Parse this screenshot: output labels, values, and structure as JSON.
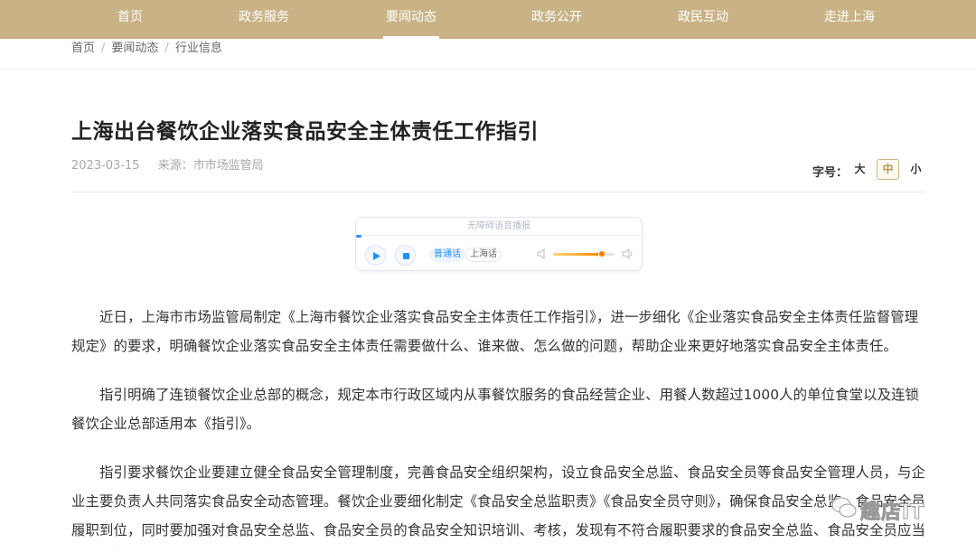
{
  "nav": {
    "items": [
      {
        "label": "首页"
      },
      {
        "label": "政务服务"
      },
      {
        "label": "要闻动态",
        "active": true
      },
      {
        "label": "政务公开"
      },
      {
        "label": "政民互动"
      },
      {
        "label": "走进上海"
      }
    ]
  },
  "breadcrumb": [
    "首页",
    "要闻动态",
    "行业信息"
  ],
  "article": {
    "title": "上海出台餐饮企业落实食品安全主体责任工作指引",
    "date": "2023-03-15",
    "source": "来源：市市场监管局"
  },
  "font_size": {
    "label": "字号：",
    "options": [
      "大",
      "中",
      "小"
    ],
    "selected": "中"
  },
  "player": {
    "header": "无障碍语音播报",
    "lang_options": [
      "普通话",
      "上海话"
    ],
    "selected_lang": "普通话",
    "volume": 0.8
  },
  "body": {
    "paragraphs": [
      "近日，上海市市场监管局制定《上海市餐饮企业落实食品安全主体责任工作指引》，进一步细化《企业落实食品安全主体责任监督管理规定》的要求，明确餐饮企业落实食品安全主体责任需要做什么、谁来做、怎么做的问题，帮助企业来更好地落实食品安全主体责任。",
      "指引明确了连锁餐饮企业总部的概念，规定本市行政区域内从事餐饮服务的食品经营企业、用餐人数超过1000人的单位食堂以及连锁餐饮企业总部适用本《指引》。",
      "指引要求餐饮企业要建立健全食品安全管理制度，完善食品安全组织架构，设立食品安全总监、食品安全员等食品安全管理人员，与企业主要负责人共同落实食品安全动态管理。餐饮企业要细化制定《食品安全总监职责》《食品安全员守则》，确保食品安全总监、食品安全员履职到位，同时要加强对食品安全总监、食品安全员的食品安全知识培训、考核，发现有不符合履职要求的食品安全总监、食品安全员应当及时调整。"
    ]
  },
  "watermark": {
    "text": "趣店IT"
  }
}
